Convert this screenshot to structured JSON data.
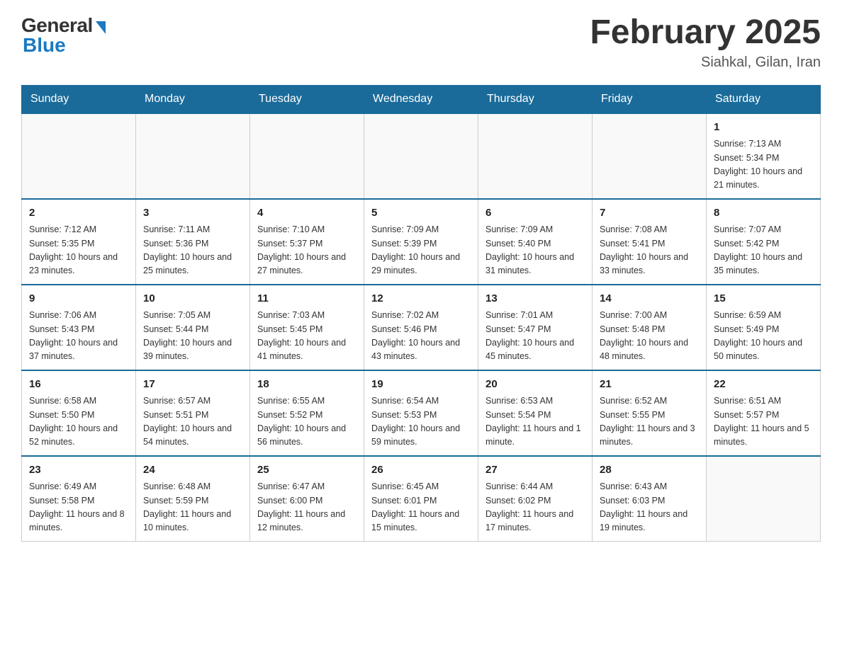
{
  "header": {
    "logo_general": "General",
    "logo_blue": "Blue",
    "title": "February 2025",
    "subtitle": "Siahkal, Gilan, Iran"
  },
  "days_of_week": [
    "Sunday",
    "Monday",
    "Tuesday",
    "Wednesday",
    "Thursday",
    "Friday",
    "Saturday"
  ],
  "weeks": [
    [
      {
        "day": null
      },
      {
        "day": null
      },
      {
        "day": null
      },
      {
        "day": null
      },
      {
        "day": null
      },
      {
        "day": null
      },
      {
        "day": 1,
        "sunrise": "7:13 AM",
        "sunset": "5:34 PM",
        "daylight": "10 hours and 21 minutes."
      }
    ],
    [
      {
        "day": 2,
        "sunrise": "7:12 AM",
        "sunset": "5:35 PM",
        "daylight": "10 hours and 23 minutes."
      },
      {
        "day": 3,
        "sunrise": "7:11 AM",
        "sunset": "5:36 PM",
        "daylight": "10 hours and 25 minutes."
      },
      {
        "day": 4,
        "sunrise": "7:10 AM",
        "sunset": "5:37 PM",
        "daylight": "10 hours and 27 minutes."
      },
      {
        "day": 5,
        "sunrise": "7:09 AM",
        "sunset": "5:39 PM",
        "daylight": "10 hours and 29 minutes."
      },
      {
        "day": 6,
        "sunrise": "7:09 AM",
        "sunset": "5:40 PM",
        "daylight": "10 hours and 31 minutes."
      },
      {
        "day": 7,
        "sunrise": "7:08 AM",
        "sunset": "5:41 PM",
        "daylight": "10 hours and 33 minutes."
      },
      {
        "day": 8,
        "sunrise": "7:07 AM",
        "sunset": "5:42 PM",
        "daylight": "10 hours and 35 minutes."
      }
    ],
    [
      {
        "day": 9,
        "sunrise": "7:06 AM",
        "sunset": "5:43 PM",
        "daylight": "10 hours and 37 minutes."
      },
      {
        "day": 10,
        "sunrise": "7:05 AM",
        "sunset": "5:44 PM",
        "daylight": "10 hours and 39 minutes."
      },
      {
        "day": 11,
        "sunrise": "7:03 AM",
        "sunset": "5:45 PM",
        "daylight": "10 hours and 41 minutes."
      },
      {
        "day": 12,
        "sunrise": "7:02 AM",
        "sunset": "5:46 PM",
        "daylight": "10 hours and 43 minutes."
      },
      {
        "day": 13,
        "sunrise": "7:01 AM",
        "sunset": "5:47 PM",
        "daylight": "10 hours and 45 minutes."
      },
      {
        "day": 14,
        "sunrise": "7:00 AM",
        "sunset": "5:48 PM",
        "daylight": "10 hours and 48 minutes."
      },
      {
        "day": 15,
        "sunrise": "6:59 AM",
        "sunset": "5:49 PM",
        "daylight": "10 hours and 50 minutes."
      }
    ],
    [
      {
        "day": 16,
        "sunrise": "6:58 AM",
        "sunset": "5:50 PM",
        "daylight": "10 hours and 52 minutes."
      },
      {
        "day": 17,
        "sunrise": "6:57 AM",
        "sunset": "5:51 PM",
        "daylight": "10 hours and 54 minutes."
      },
      {
        "day": 18,
        "sunrise": "6:55 AM",
        "sunset": "5:52 PM",
        "daylight": "10 hours and 56 minutes."
      },
      {
        "day": 19,
        "sunrise": "6:54 AM",
        "sunset": "5:53 PM",
        "daylight": "10 hours and 59 minutes."
      },
      {
        "day": 20,
        "sunrise": "6:53 AM",
        "sunset": "5:54 PM",
        "daylight": "11 hours and 1 minute."
      },
      {
        "day": 21,
        "sunrise": "6:52 AM",
        "sunset": "5:55 PM",
        "daylight": "11 hours and 3 minutes."
      },
      {
        "day": 22,
        "sunrise": "6:51 AM",
        "sunset": "5:57 PM",
        "daylight": "11 hours and 5 minutes."
      }
    ],
    [
      {
        "day": 23,
        "sunrise": "6:49 AM",
        "sunset": "5:58 PM",
        "daylight": "11 hours and 8 minutes."
      },
      {
        "day": 24,
        "sunrise": "6:48 AM",
        "sunset": "5:59 PM",
        "daylight": "11 hours and 10 minutes."
      },
      {
        "day": 25,
        "sunrise": "6:47 AM",
        "sunset": "6:00 PM",
        "daylight": "11 hours and 12 minutes."
      },
      {
        "day": 26,
        "sunrise": "6:45 AM",
        "sunset": "6:01 PM",
        "daylight": "11 hours and 15 minutes."
      },
      {
        "day": 27,
        "sunrise": "6:44 AM",
        "sunset": "6:02 PM",
        "daylight": "11 hours and 17 minutes."
      },
      {
        "day": 28,
        "sunrise": "6:43 AM",
        "sunset": "6:03 PM",
        "daylight": "11 hours and 19 minutes."
      },
      {
        "day": null
      }
    ]
  ]
}
